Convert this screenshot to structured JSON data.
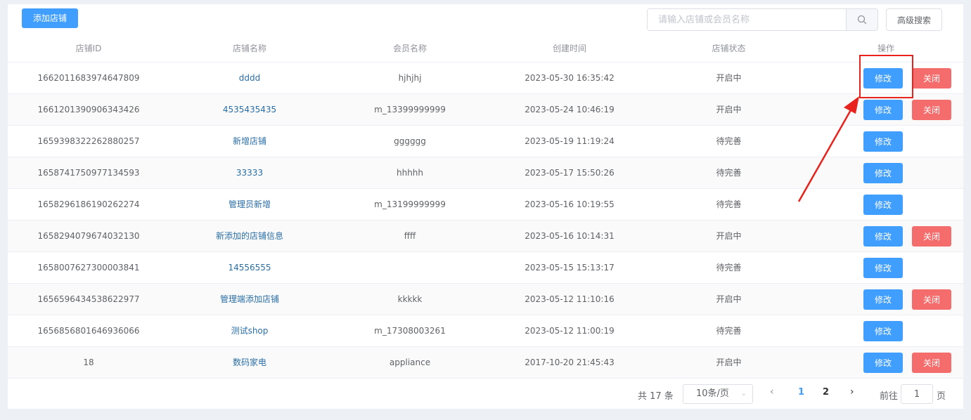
{
  "toolbar": {
    "add_label": "添加店铺",
    "search_placeholder": "请输入店铺或会员名称",
    "search_icon": "search-icon",
    "advanced_label": "高级搜索"
  },
  "table": {
    "headers": [
      "店铺ID",
      "店铺名称",
      "会员名称",
      "创建时间",
      "店铺状态",
      "操作"
    ],
    "edit_label": "修改",
    "close_label": "关闭",
    "rows": [
      {
        "id": "1662011683974647809",
        "name": "dddd",
        "member": "hjhjhj",
        "created": "2023-05-30 16:35:42",
        "status": "开启中",
        "closable": true
      },
      {
        "id": "1661201390906343426",
        "name": "4535435435",
        "member": "m_13399999999",
        "created": "2023-05-24 10:46:19",
        "status": "开启中",
        "closable": true
      },
      {
        "id": "1659398322262880257",
        "name": "新增店铺",
        "member": "gggggg",
        "created": "2023-05-19 11:19:24",
        "status": "待完善",
        "closable": false
      },
      {
        "id": "1658741750977134593",
        "name": "33333",
        "member": "hhhhh",
        "created": "2023-05-17 15:50:26",
        "status": "待完善",
        "closable": false
      },
      {
        "id": "1658296186190262274",
        "name": "管理员新增",
        "member": "m_13199999999",
        "created": "2023-05-16 10:19:55",
        "status": "待完善",
        "closable": false
      },
      {
        "id": "1658294079674032130",
        "name": "新添加的店铺信息",
        "member": "ffff",
        "created": "2023-05-16 10:14:31",
        "status": "开启中",
        "closable": true
      },
      {
        "id": "1658007627300003841",
        "name": "14556555",
        "member": "",
        "created": "2023-05-15 15:13:17",
        "status": "待完善",
        "closable": false
      },
      {
        "id": "1656596434538622977",
        "name": "管理端添加店铺",
        "member": "kkkkk",
        "created": "2023-05-12 11:10:16",
        "status": "开启中",
        "closable": true
      },
      {
        "id": "1656856801646936066",
        "name": "测试shop",
        "member": "m_17308003261",
        "created": "2023-05-12 11:00:19",
        "status": "待完善",
        "closable": false
      },
      {
        "id": "18",
        "name": "数码家电",
        "member": "appliance",
        "created": "2017-10-20 21:45:43",
        "status": "开启中",
        "closable": true
      }
    ]
  },
  "pagination": {
    "total": "共 17 条",
    "page_size": "10条/页",
    "pages": [
      "1",
      "2"
    ],
    "current_page": "1",
    "goto_label": "前往",
    "goto_value": "1",
    "goto_unit": "页"
  },
  "annotation": {
    "highlight_color": "#e8221c"
  }
}
